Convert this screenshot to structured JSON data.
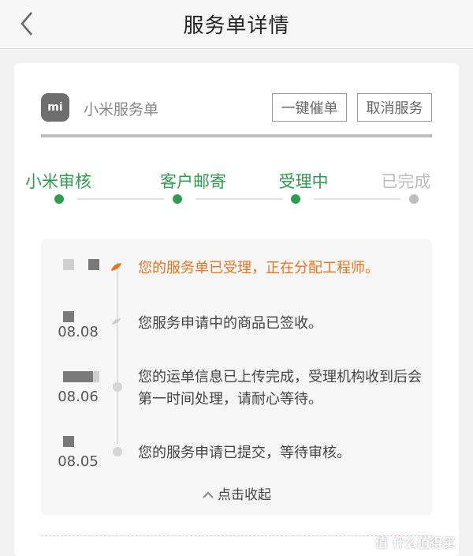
{
  "nav": {
    "title": "服务单详情"
  },
  "shop": {
    "logo_text": "mi",
    "name": "小米服务单"
  },
  "actions": {
    "urge_label": "一键催单",
    "cancel_label": "取消服务"
  },
  "steps": [
    {
      "label": "小米审核",
      "state": "done"
    },
    {
      "label": "客户邮寄",
      "state": "done"
    },
    {
      "label": "受理中",
      "state": "done"
    },
    {
      "label": "已完成",
      "state": "pending"
    }
  ],
  "colors": {
    "accent_green": "#2e9d4f",
    "accent_orange": "#e8741f",
    "pending_gray": "#bdbdbd"
  },
  "timeline": [
    {
      "date": "",
      "text": "您的服务单已受理，正在分配工程师。",
      "active": true
    },
    {
      "date": "08.08",
      "text": "您服务申请中的商品已签收。",
      "active": false
    },
    {
      "date": "08.06",
      "text": "您的运单信息已上传完成，受理机构收到后会第一时间处理，请耐心等待。",
      "active": false
    },
    {
      "date": "08.05",
      "text": "您的服务申请已提交，等待审核。",
      "active": false
    }
  ],
  "collapse_label": "点击收起",
  "watermark": "值 什么值得买"
}
